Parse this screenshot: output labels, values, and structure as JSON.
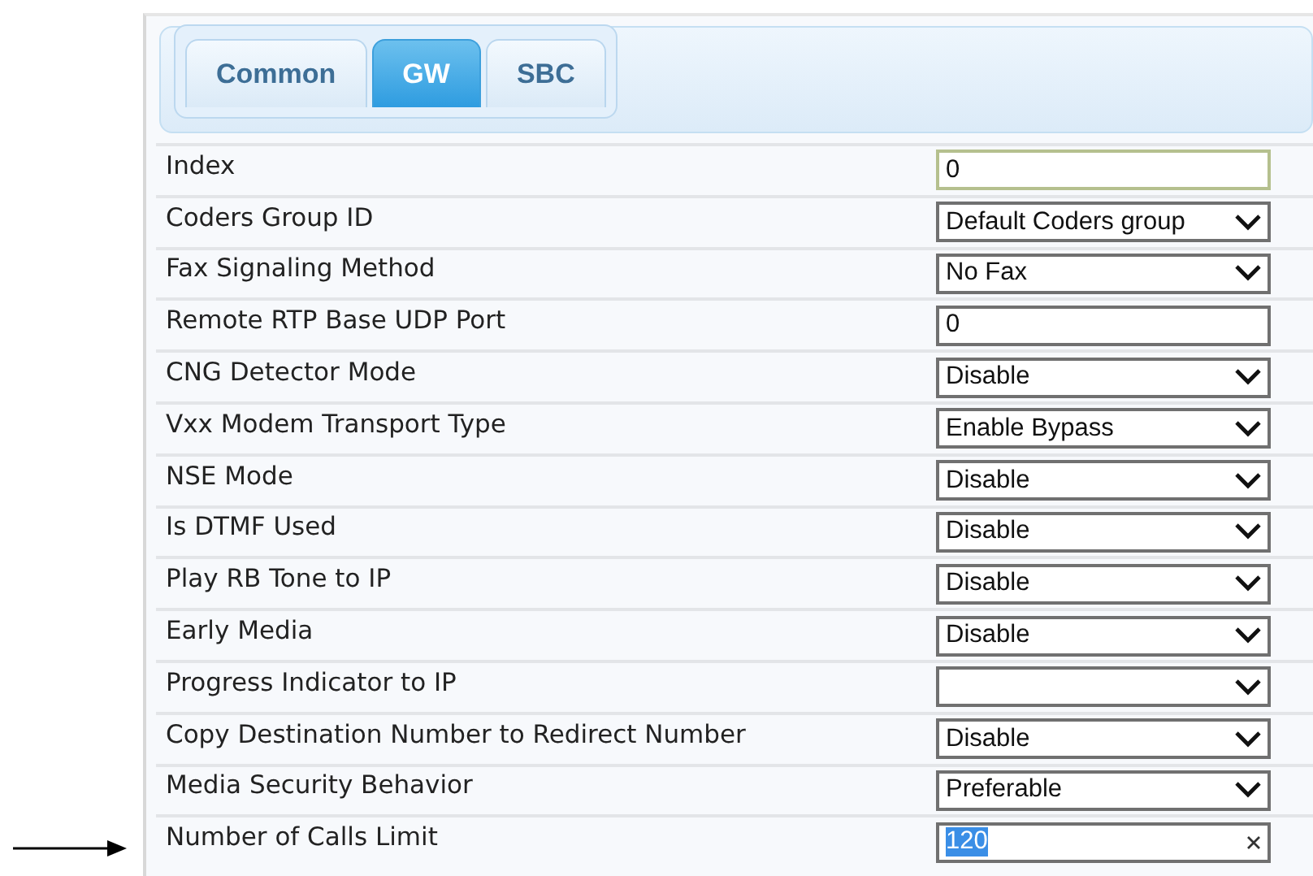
{
  "tabs": [
    {
      "label": "Common",
      "selected": false
    },
    {
      "label": "GW",
      "selected": true
    },
    {
      "label": "SBC",
      "selected": false
    }
  ],
  "rows": [
    {
      "label": "Index",
      "kind": "text",
      "value": "0",
      "focused": true
    },
    {
      "label": "Coders Group ID",
      "kind": "select",
      "value": "Default Coders group",
      "focused": false
    },
    {
      "label": "Fax Signaling Method",
      "kind": "select",
      "value": "No Fax",
      "focused": false
    },
    {
      "label": "Remote RTP Base UDP Port",
      "kind": "text",
      "value": "0",
      "focused": false
    },
    {
      "label": "CNG Detector Mode",
      "kind": "select",
      "value": "Disable",
      "focused": false
    },
    {
      "label": "Vxx Modem Transport Type",
      "kind": "select",
      "value": "Enable Bypass",
      "focused": false
    },
    {
      "label": "NSE Mode",
      "kind": "select",
      "value": "Disable",
      "focused": false
    },
    {
      "label": "Is DTMF Used",
      "kind": "select",
      "value": "Disable",
      "focused": false
    },
    {
      "label": "Play RB Tone to IP",
      "kind": "select",
      "value": "Disable",
      "focused": false
    },
    {
      "label": "Early Media",
      "kind": "select",
      "value": "Disable",
      "focused": false
    },
    {
      "label": "Progress Indicator to IP",
      "kind": "select",
      "focused": false
    },
    {
      "label": "Copy Destination Number to Redirect Number",
      "kind": "select",
      "value": "Disable",
      "focused": false
    },
    {
      "label": "Media Security Behavior",
      "kind": "select",
      "value": "Preferable",
      "focused": false
    },
    {
      "label": "Number of Calls Limit",
      "kind": "clearable",
      "value": "120",
      "focused": false,
      "value_selected": true
    }
  ]
}
